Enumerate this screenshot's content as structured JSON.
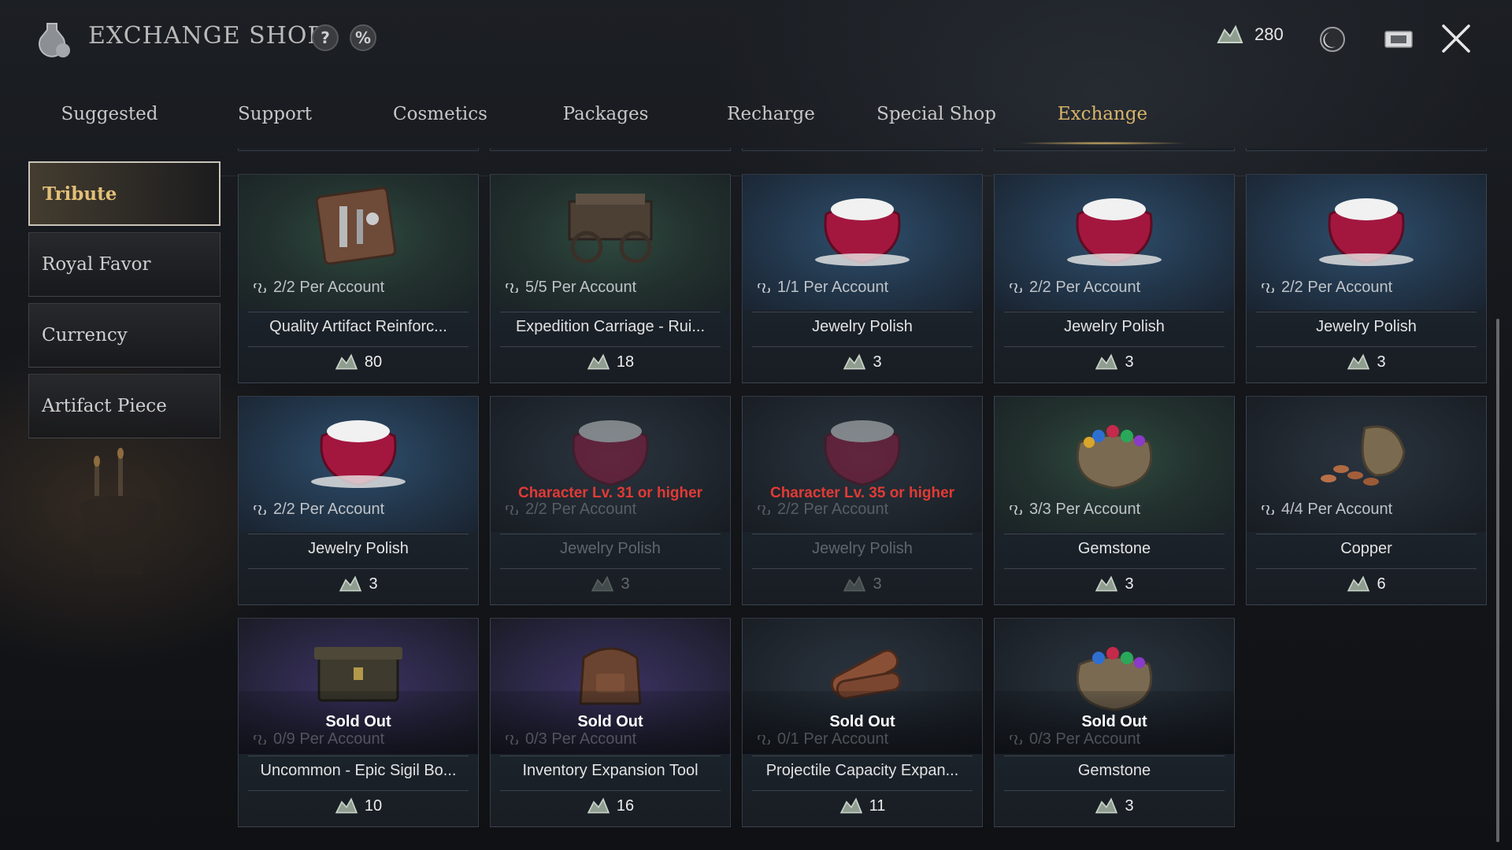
{
  "header": {
    "title": "EXCHANGE SHOP",
    "help_label": "?",
    "discount_label": "%",
    "currency_value": "280",
    "icons": {
      "logo": "potion-bag-icon",
      "currency": "tribute-coin-icon",
      "moon": "moon-coin-icon",
      "ticket": "ticket-icon",
      "close": "close-icon"
    }
  },
  "tabs": [
    {
      "label": "Suggested",
      "active": false
    },
    {
      "label": "Support",
      "active": false
    },
    {
      "label": "Cosmetics",
      "active": false
    },
    {
      "label": "Packages",
      "active": false
    },
    {
      "label": "Recharge",
      "active": false
    },
    {
      "label": "Special Shop",
      "active": false
    },
    {
      "label": "Exchange",
      "active": true
    }
  ],
  "sidebar": {
    "items": [
      {
        "label": "Tribute",
        "active": true
      },
      {
        "label": "Royal Favor",
        "active": false
      },
      {
        "label": "Currency",
        "active": false
      },
      {
        "label": "Artifact Piece",
        "active": false
      }
    ]
  },
  "items": [
    {
      "name": "Quality Artifact Reinforc...",
      "limit": "2/2 Per Account",
      "price": "80",
      "state": "available",
      "icon": "artifact-kit-icon"
    },
    {
      "name": "Expedition Carriage - Rui...",
      "limit": "5/5 Per Account",
      "price": "18",
      "state": "available",
      "icon": "carriage-icon"
    },
    {
      "name": "Jewelry Polish",
      "limit": "1/1 Per Account",
      "price": "3",
      "state": "available",
      "icon": "polish-bag-icon"
    },
    {
      "name": "Jewelry Polish",
      "limit": "2/2 Per Account",
      "price": "3",
      "state": "available",
      "icon": "polish-bag-icon"
    },
    {
      "name": "Jewelry Polish",
      "limit": "2/2 Per Account",
      "price": "3",
      "state": "available",
      "icon": "polish-bag-icon"
    },
    {
      "name": "Jewelry Polish",
      "limit": "2/2 Per Account",
      "price": "3",
      "state": "available",
      "icon": "polish-bag-icon"
    },
    {
      "name": "Jewelry Polish",
      "limit": "2/2 Per Account",
      "price": "3",
      "state": "locked",
      "requirement": "Character Lv. 31 or higher",
      "icon": "polish-bag-icon"
    },
    {
      "name": "Jewelry Polish",
      "limit": "2/2 Per Account",
      "price": "3",
      "state": "locked",
      "requirement": "Character Lv. 35 or higher",
      "icon": "polish-bag-icon"
    },
    {
      "name": "Gemstone",
      "limit": "3/3 Per Account",
      "price": "3",
      "state": "available",
      "icon": "gem-sack-icon"
    },
    {
      "name": "Copper",
      "limit": "4/4 Per Account",
      "price": "6",
      "state": "available",
      "icon": "copper-pouch-icon"
    },
    {
      "name": "Uncommon - Epic Sigil Bo...",
      "limit": "0/9 Per Account",
      "price": "10",
      "state": "soldout",
      "status": "Sold Out",
      "icon": "sigil-chest-icon"
    },
    {
      "name": "Inventory Expansion Tool",
      "limit": "0/3 Per Account",
      "price": "16",
      "state": "soldout",
      "status": "Sold Out",
      "icon": "backpack-icon"
    },
    {
      "name": "Projectile Capacity Expan...",
      "limit": "0/1 Per Account",
      "price": "11",
      "state": "soldout",
      "status": "Sold Out",
      "icon": "quiver-icon"
    },
    {
      "name": "Gemstone",
      "limit": "0/3 Per Account",
      "price": "3",
      "state": "soldout",
      "status": "Sold Out",
      "icon": "gem-sack-icon"
    }
  ],
  "colors": {
    "accent_gold": "#d8b46a",
    "requirement_red": "#e23a35",
    "text": "#e2e2e2"
  }
}
